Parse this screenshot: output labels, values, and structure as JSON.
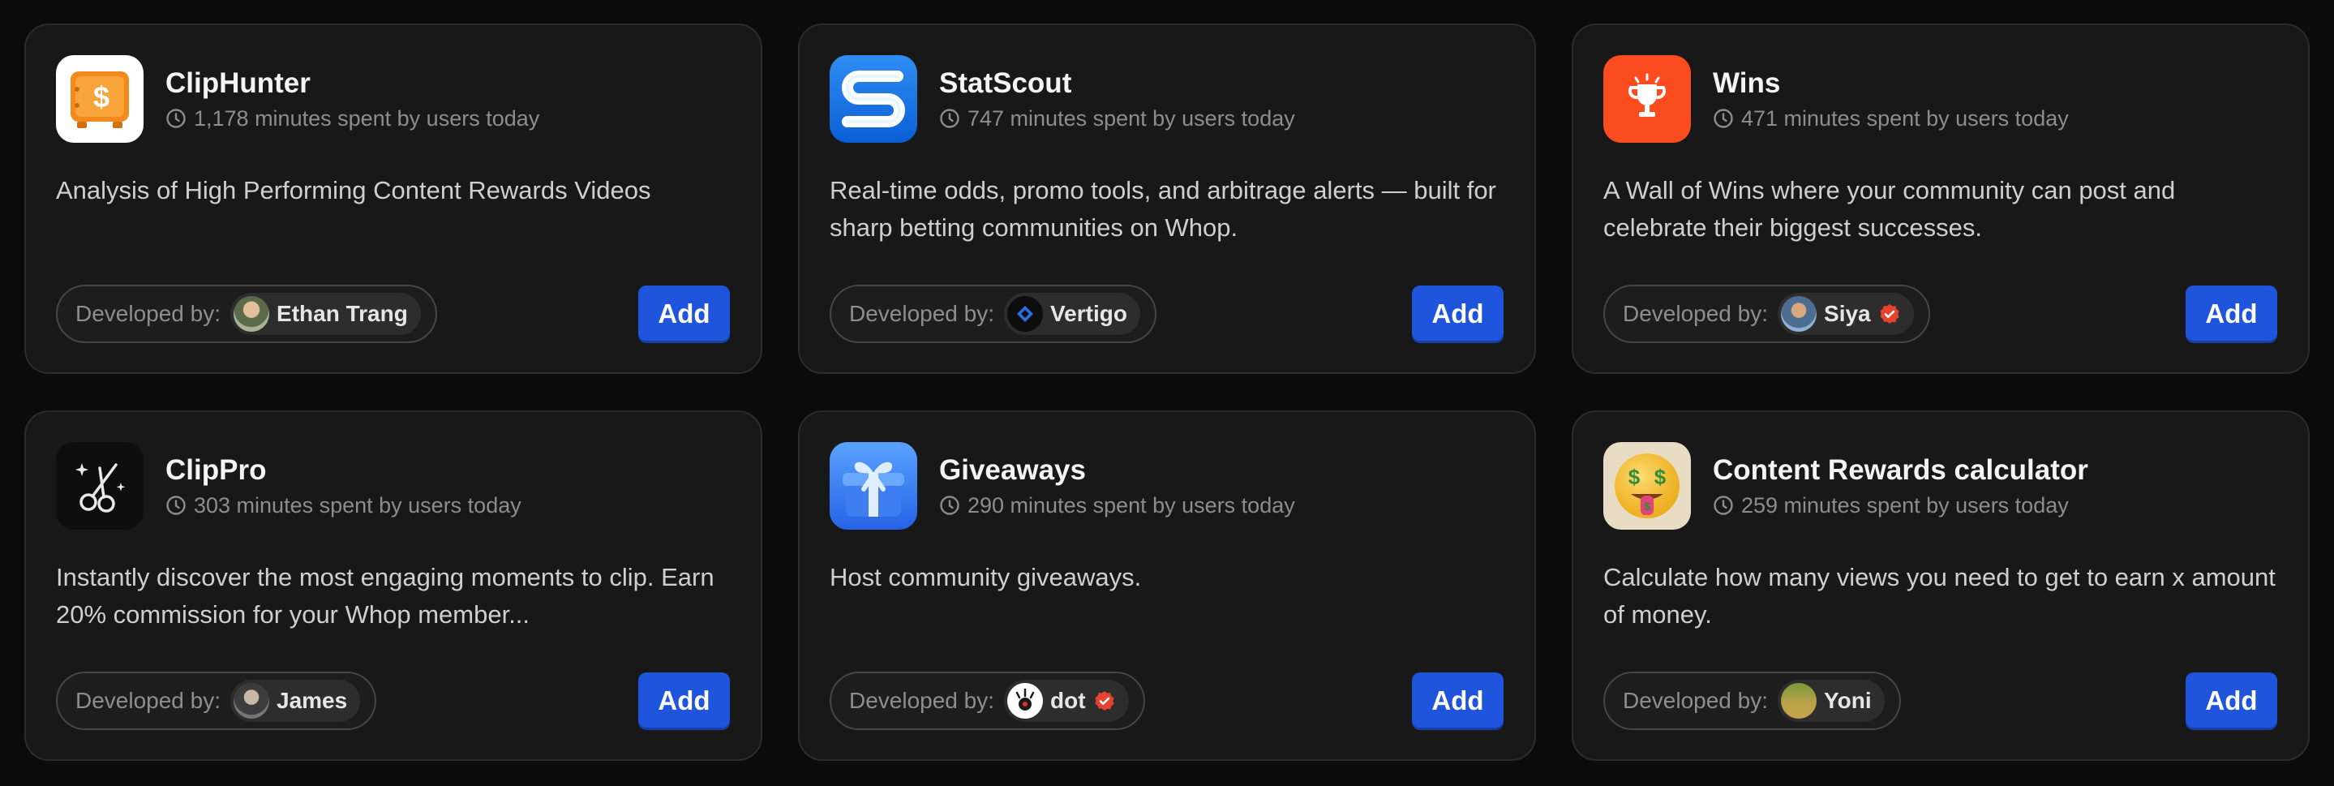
{
  "cards": [
    {
      "name": "ClipHunter",
      "usage": "1,178 minutes spent by users today",
      "description": "Analysis of High Performing Content Rewards Videos",
      "developer_label": "Developed by:",
      "developer": "Ethan Trang",
      "verified": false,
      "icon": "safe-dollar-icon",
      "add_label": "Add"
    },
    {
      "name": "StatScout",
      "usage": "747 minutes spent by users today",
      "description": "Real-time odds, promo tools, and arbitrage alerts — built for sharp betting communities on Whop.",
      "developer_label": "Developed by:",
      "developer": "Vertigo",
      "verified": false,
      "icon": "statscout-s-icon",
      "add_label": "Add"
    },
    {
      "name": "Wins",
      "usage": "471 minutes spent by users today",
      "description": "A Wall of Wins where your community can post and celebrate their biggest successes.",
      "developer_label": "Developed by:",
      "developer": "Siya",
      "verified": true,
      "icon": "trophy-icon",
      "add_label": "Add"
    },
    {
      "name": "ClipPro",
      "usage": "303 minutes spent by users today",
      "description": "Instantly discover the most engaging moments to clip. Earn 20% commission for your Whop member...",
      "developer_label": "Developed by:",
      "developer": "James",
      "verified": false,
      "icon": "scissors-icon",
      "add_label": "Add"
    },
    {
      "name": "Giveaways",
      "usage": "290 minutes spent by users today",
      "description": "Host community giveaways.",
      "developer_label": "Developed by:",
      "developer": "dot",
      "verified": true,
      "icon": "gift-icon",
      "add_label": "Add"
    },
    {
      "name": "Content Rewards calculator",
      "usage": "259 minutes spent by users today",
      "description": "Calculate how many views you need to get to earn x amount of money.",
      "developer_label": "Developed by:",
      "developer": "Yoni",
      "verified": false,
      "icon": "money-mouth-face-icon",
      "add_label": "Add"
    }
  ],
  "colors": {
    "page_bg": "#0b0b0b",
    "card_bg": "#181818",
    "add_button": "#1f54dc",
    "verified_badge": "#e5432d"
  }
}
